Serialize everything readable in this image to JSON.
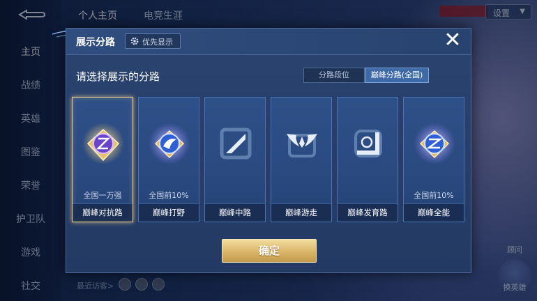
{
  "app": {
    "top_tabs": [
      {
        "label": "个人主页",
        "active": true
      },
      {
        "label": "电竞生涯",
        "active": false
      }
    ],
    "settings_label": "设置",
    "side_nav": [
      {
        "label": "主页",
        "active": true
      },
      {
        "label": "战绩",
        "active": false
      },
      {
        "label": "英雄",
        "active": false
      },
      {
        "label": "图鉴",
        "active": false
      },
      {
        "label": "荣誉",
        "active": false
      },
      {
        "label": "护卫队",
        "active": false
      },
      {
        "label": "游戏",
        "active": false
      },
      {
        "label": "社交",
        "active": false
      }
    ],
    "recent_visitors_label": "最近访客>",
    "right_actions": {
      "vision": "顾问",
      "swap_hero": "换英雄"
    }
  },
  "modal": {
    "title": "展示分路",
    "priority_button": "优先显示",
    "close_icon": "close-icon",
    "section_title": "请选择展示的分路",
    "segments": [
      {
        "label": "分路段位",
        "active": false
      },
      {
        "label": "巅峰分路(全国)",
        "active": true
      }
    ],
    "cards": [
      {
        "rank": "全国一万强",
        "label": "巅峰对抗路",
        "selected": true,
        "icon": "sword-emblem-icon",
        "has_rank": true
      },
      {
        "rank": "全国前10%",
        "label": "巅峰打野",
        "selected": false,
        "icon": "claw-emblem-icon",
        "has_rank": true
      },
      {
        "rank": "",
        "label": "巅峰中路",
        "selected": false,
        "icon": "slash-emblem-icon",
        "has_rank": false
      },
      {
        "rank": "",
        "label": "巅峰游走",
        "selected": false,
        "icon": "wings-emblem-icon",
        "has_rank": false
      },
      {
        "rank": "",
        "label": "巅峰发育路",
        "selected": false,
        "icon": "arrow-emblem-icon",
        "has_rank": false
      },
      {
        "rank": "全国前10%",
        "label": "巅峰全能",
        "selected": false,
        "icon": "cross-emblem-icon",
        "has_rank": true
      }
    ],
    "confirm_label": "确定"
  },
  "colors": {
    "gold_accent": "#f2d08a",
    "card_blue": "#2e5088",
    "modal_bg": "#2a4470",
    "active_segment": "#3f6aa8"
  }
}
